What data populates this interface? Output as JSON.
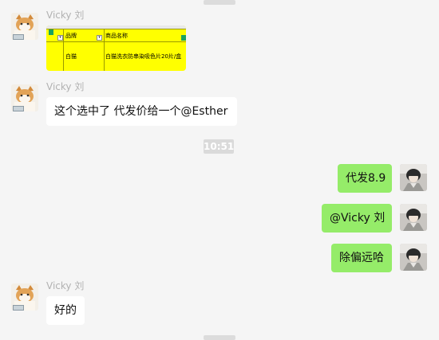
{
  "chat": {
    "time_divider": "10:51",
    "messages": [
      {
        "id": "m1",
        "sender": "Vicky 刘",
        "type": "image",
        "image": {
          "headers": [
            "品牌",
            "商品名称"
          ],
          "row": [
            "白猫",
            "白猫洗衣防串染吸色片20片/盒"
          ]
        }
      },
      {
        "id": "m2",
        "sender": "Vicky 刘",
        "type": "text",
        "text": "这个选中了  代发价给一个@Esther"
      },
      {
        "id": "m3",
        "sender": "",
        "type": "text",
        "direction": "out",
        "text": "代发8.9"
      },
      {
        "id": "m4",
        "sender": "",
        "type": "text",
        "direction": "out",
        "text": "@Vicky 刘"
      },
      {
        "id": "m5",
        "sender": "",
        "type": "text",
        "direction": "out",
        "text": "除偏远哈"
      },
      {
        "id": "m6",
        "sender": "Vicky 刘",
        "type": "text",
        "text": "好的"
      }
    ]
  },
  "avatars": {
    "incoming": "cat-avatar",
    "outgoing": "person-avatar"
  },
  "colors": {
    "background": "#f5f5f5",
    "incoming_bubble": "#ffffff",
    "outgoing_bubble": "#95ec69",
    "sender_name": "#b2b2b2",
    "image_fill": "#ffff00"
  }
}
